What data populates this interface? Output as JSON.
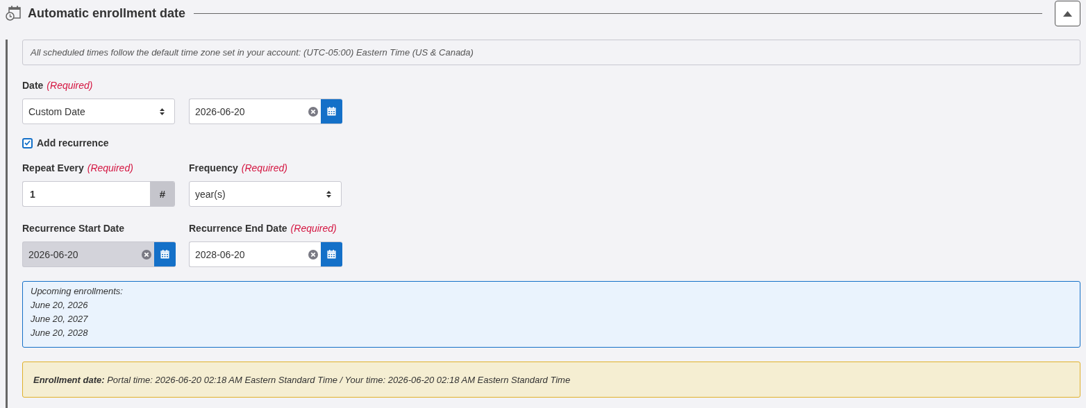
{
  "section": {
    "title": "Automatic enrollment date",
    "collapsed": false
  },
  "timezone_note": "All scheduled times follow the default time zone set in your account: (UTC-05:00) Eastern Time (US & Canada)",
  "date": {
    "label": "Date",
    "required": "(Required)",
    "type_select": {
      "kind": "select",
      "value": "Custom Date",
      "disabled": false
    },
    "date_field": {
      "kind": "date",
      "value": "2026-06-20",
      "disabled": false
    }
  },
  "recurrence": {
    "label": "Add recurrence",
    "checked": true
  },
  "repeat_every": {
    "label": "Repeat Every",
    "required": "(Required)",
    "field": {
      "kind": "number",
      "value": "1",
      "addon": "#",
      "disabled": false
    }
  },
  "frequency": {
    "label": "Frequency",
    "required": "(Required)",
    "field": {
      "kind": "select",
      "value": "year(s)",
      "disabled": false
    }
  },
  "start_date": {
    "label": "Recurrence Start Date",
    "field": {
      "kind": "date",
      "value": "2026-06-20",
      "disabled": true
    }
  },
  "end_date": {
    "label": "Recurrence End Date",
    "required": "(Required)",
    "field": {
      "kind": "date",
      "value": "2028-06-20",
      "disabled": false
    }
  },
  "upcoming": {
    "heading": "Upcoming enrollments:",
    "dates": [
      "June 20, 2026",
      "June 20, 2027",
      "June 20, 2028"
    ]
  },
  "enrollment_note": "**Enrollment date:** Portal time: 2026-06-20 02:18 AM Eastern Standard Time / Your time: 2026-06-20 02:18 AM Eastern Standard Time"
}
